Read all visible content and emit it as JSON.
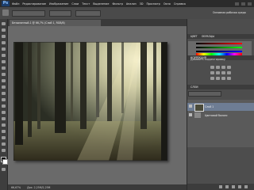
{
  "app": {
    "logo": "Ps"
  },
  "menubar": {
    "items": [
      "Файл",
      "Редактирование",
      "Изображение",
      "Слои",
      "Текст",
      "Выделение",
      "Фильтр",
      "Анализ",
      "3D",
      "Просмотр",
      "Окно",
      "Справка"
    ]
  },
  "optionsbar": {
    "workspace_label": "Основная рабочая среда"
  },
  "document": {
    "tab_title": "Безымянный-1 @ 66,7% (Слой 1, RGB/8)"
  },
  "statusbar": {
    "zoom": "66,67%",
    "info": "Док: 2,25М/2,25М"
  },
  "panels": {
    "color_tab": "ЦВЕТ",
    "swatches_tab": "ОБРАЗЦЫ",
    "adjustments_tab": "КОРРЕКЦИЯ",
    "adjustments_title": "Добавить корректировку",
    "layers_tab": "СЛОИ"
  },
  "layers": [
    {
      "name": "Слой 1"
    },
    {
      "name": "Цветовой баланс"
    }
  ],
  "colors": {
    "accent": "#6e7d94",
    "workspace_bg": "#535353"
  }
}
